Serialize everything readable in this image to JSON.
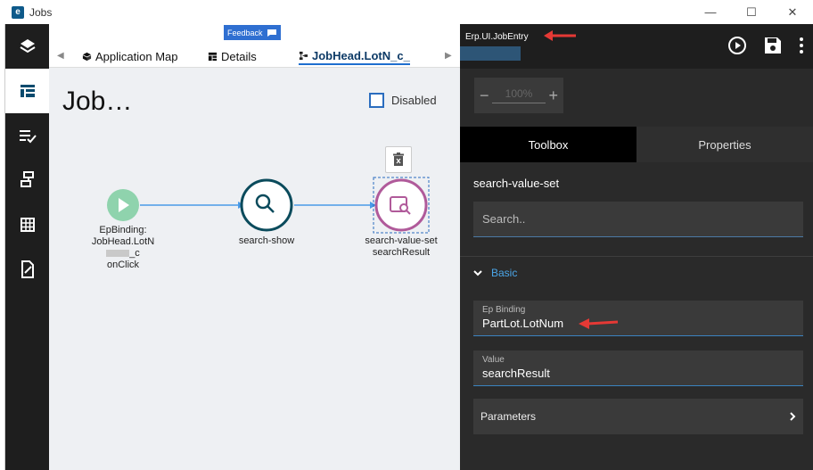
{
  "window": {
    "title": "Jobs",
    "controls": [
      "—",
      "☐",
      "✕"
    ]
  },
  "sidebar": {
    "icons": [
      "layers-icon",
      "layout-icon",
      "checklist-icon",
      "flow-icon",
      "grid-icon",
      "edit-doc-icon"
    ],
    "active_index": 1
  },
  "tabs": {
    "feedback_label": "Feedback",
    "items": [
      {
        "label": "Application Map",
        "icon": "cube-icon"
      },
      {
        "label": "Details",
        "icon": "table-icon"
      },
      {
        "label": "JobHead.LotN_c_",
        "icon": "flow-icon"
      }
    ],
    "active_index": 2
  },
  "canvas": {
    "title": "Job…",
    "disabled_label": "Disabled",
    "disabled_checked": false,
    "nodes": [
      {
        "id": "start",
        "label_lines": [
          "EpBinding:",
          "JobHead.LotN",
          "_c",
          "onClick"
        ]
      },
      {
        "id": "search-show",
        "label_lines": [
          "search-show"
        ]
      },
      {
        "id": "search-value-set",
        "label_lines": [
          "search-value-set",
          "searchResult"
        ]
      }
    ]
  },
  "right_panel": {
    "title": "Erp.UI.JobEntry",
    "zoom": {
      "value": "100%",
      "minus": "−",
      "plus": "+"
    },
    "tabs": [
      {
        "label": "Toolbox",
        "active": true
      },
      {
        "label": "Properties",
        "active": false
      }
    ],
    "component_name": "search-value-set",
    "search_placeholder": "Search..",
    "section": "Basic",
    "fields": [
      {
        "label": "Ep Binding",
        "value": "PartLot.LotNum"
      },
      {
        "label": "Value",
        "value": "searchResult"
      }
    ],
    "parameters_label": "Parameters"
  },
  "colors": {
    "accent": "#1f6fcf",
    "start_node": "#8fd3ad",
    "search_node": "#0b4b5c",
    "value_node": "#b05a9a",
    "arrow_red": "#e53935"
  }
}
